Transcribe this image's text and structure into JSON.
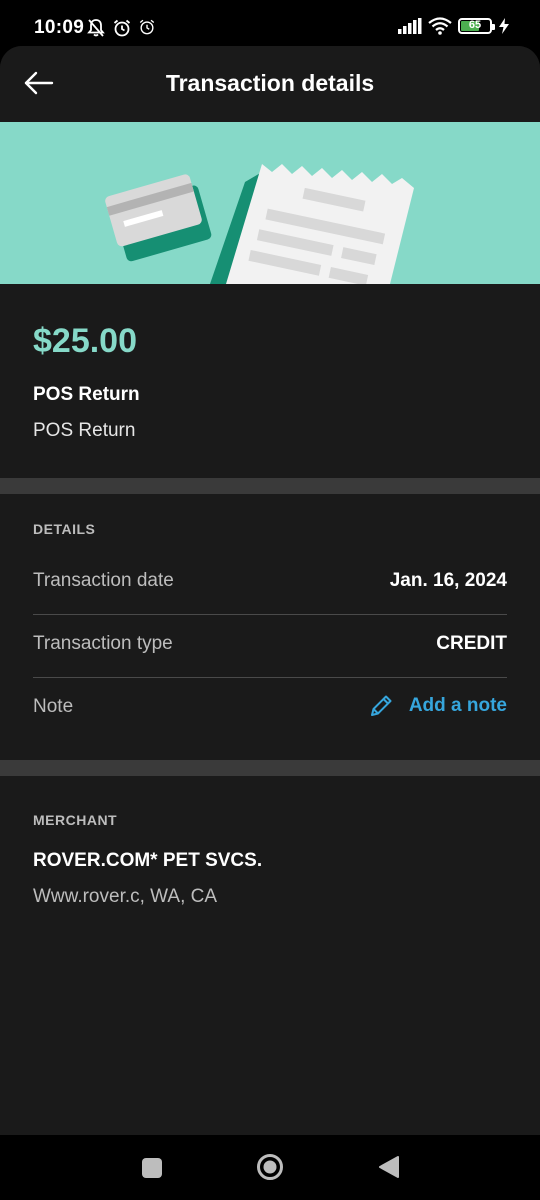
{
  "status_bar": {
    "time": "10:09",
    "battery_level": "65",
    "battery_fraction": 0.65,
    "left_icons": [
      "notifications-off-icon",
      "alarm-icon",
      "alarm-icon"
    ],
    "right_icons": [
      "signal-icon",
      "wifi-icon",
      "battery-icon",
      "charging-bolt-icon"
    ]
  },
  "header": {
    "title": "Transaction details",
    "back_icon": "arrow-left-icon"
  },
  "transaction": {
    "amount": "$25.00",
    "description_primary": "POS Return",
    "description_secondary": "POS Return"
  },
  "details": {
    "section_label": "DETAILS",
    "rows": [
      {
        "label": "Transaction date",
        "value": "Jan. 16, 2024"
      },
      {
        "label": "Transaction type",
        "value": "CREDIT"
      },
      {
        "label": "Note",
        "action_label": "Add a note",
        "action_icon": "pencil-icon"
      }
    ]
  },
  "merchant": {
    "section_label": "MERCHANT",
    "name": "ROVER.COM* PET SVCS.",
    "location": "Www.rover.c, WA, CA"
  },
  "nav": {
    "icons": [
      "recents-square-icon",
      "home-circle-icon",
      "back-triangle-icon"
    ]
  },
  "colors": {
    "accent_teal": "#86d9c8",
    "link_blue": "#36a6dd",
    "surface": "#1a1a1a",
    "divider": "#3a3a3a"
  }
}
